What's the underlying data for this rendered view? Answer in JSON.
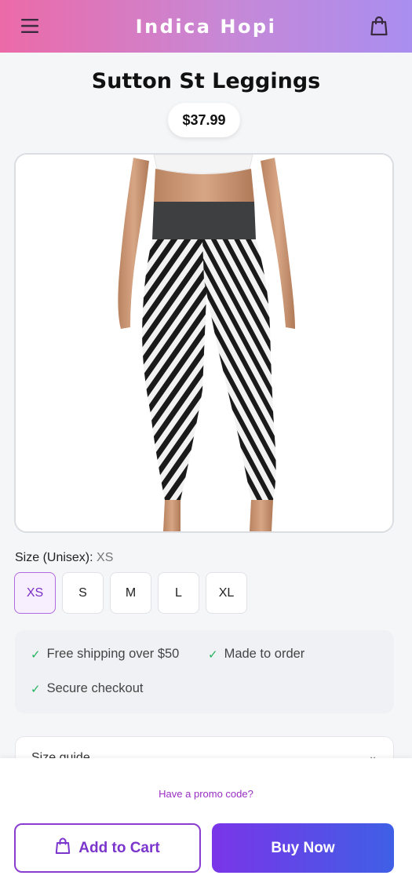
{
  "header": {
    "brand": "Indica Hopi",
    "menu_icon": "hamburger-menu-icon",
    "cart_icon": "shopping-bag-icon"
  },
  "product": {
    "title": "Sutton St Leggings",
    "price": "$37.99",
    "image_alt": "Black and white zebra pattern capri leggings on model"
  },
  "size": {
    "label": "Size (Unisex):",
    "selected": "XS",
    "options": [
      "XS",
      "S",
      "M",
      "L",
      "XL"
    ]
  },
  "features": {
    "items": [
      "Free shipping over $50",
      "Made to order",
      "Secure checkout"
    ],
    "icon": "checkmark-icon"
  },
  "accordion": {
    "label": "Size guide",
    "icon": "chevron-down-icon"
  },
  "bottom_bar": {
    "promo": "Have a promo code?",
    "add_to_cart": "Add to Cart",
    "buy_now": "Buy Now"
  },
  "colors": {
    "accent_purple": "#7b35cc",
    "gradient_start": "#ec6aa8",
    "gradient_end": "#a98ef0",
    "check_green": "#22b35e"
  }
}
